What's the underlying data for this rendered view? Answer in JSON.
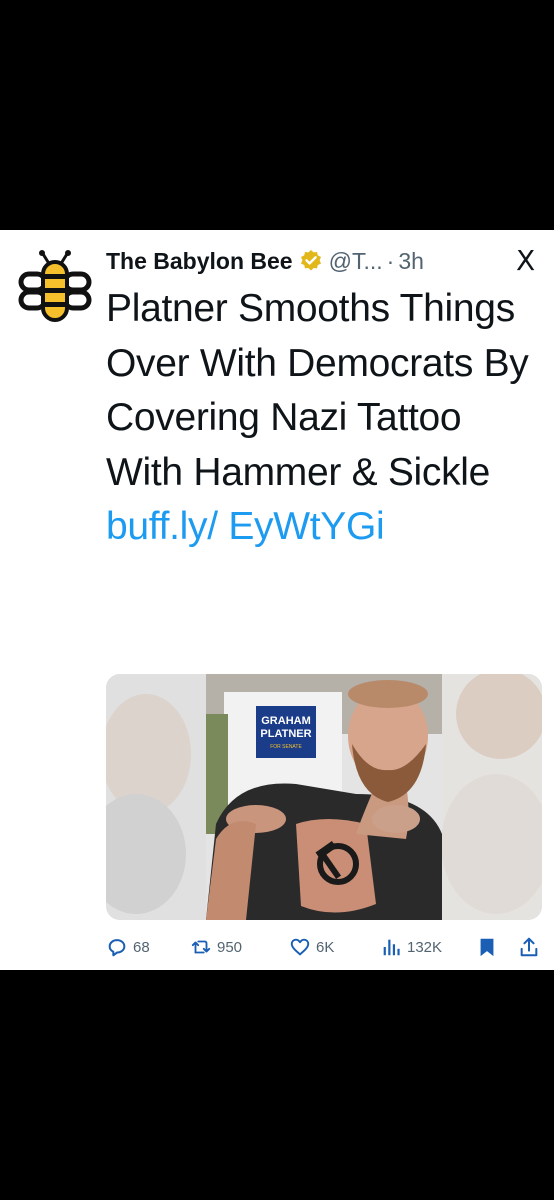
{
  "tweet": {
    "author_name": "The Babylon Bee",
    "handle": "@T...",
    "dot": "·",
    "time": "3h",
    "close_symbol": "X",
    "text_plain": "Platner Smooths Things Over With Democrats By Covering Nazi Tattoo With Hammer & Sickle",
    "link_text": "buff.ly/ EyWtYGi"
  },
  "media": {
    "sign_line1": "GRAHAM",
    "sign_line2": "PLATNER",
    "sign_line3": "FOR SENATE"
  },
  "actions": {
    "replies": "68",
    "retweets": "950",
    "likes": "6K",
    "views": "132K"
  },
  "colors": {
    "accent": "#1d9bf0",
    "verified_gold": "#e2b719",
    "bee_yellow": "#f5c02c",
    "text_primary": "#0f1419",
    "text_secondary": "#536471"
  },
  "icons": [
    "bee-logo-icon",
    "verified-badge-icon",
    "close-icon",
    "reply-icon",
    "retweet-icon",
    "like-icon",
    "views-icon",
    "bookmark-icon",
    "share-icon"
  ]
}
